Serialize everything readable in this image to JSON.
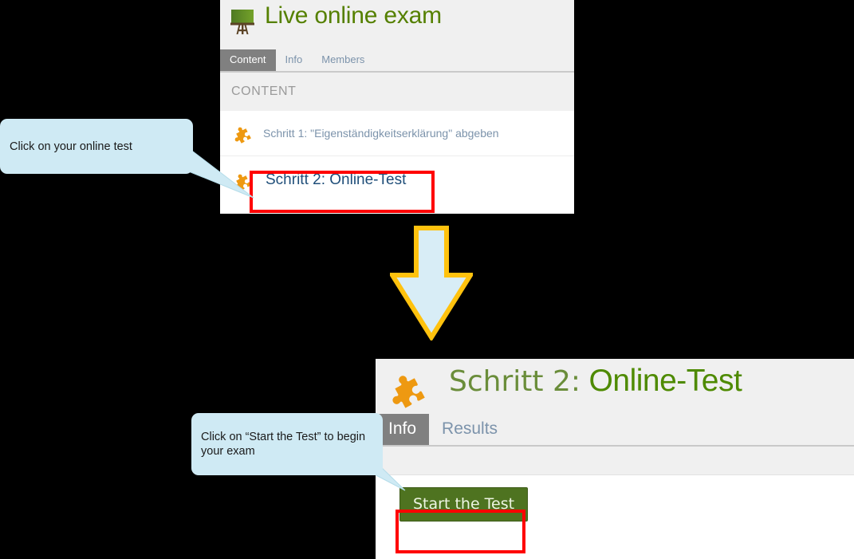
{
  "course_panel": {
    "icon": "easel-board-icon",
    "title": "Live online exam",
    "tabs": [
      {
        "label": "Content",
        "active": true
      },
      {
        "label": "Info",
        "active": false
      },
      {
        "label": "Members",
        "active": false
      }
    ],
    "section_label": "CONTENT",
    "rows": [
      {
        "icon": "puzzle-piece-icon",
        "label": "Schritt 1: \"Eigenständigkeitserklärung\" abgeben",
        "highlighted": false
      },
      {
        "icon": "puzzle-piece-icon",
        "label": "Schritt 2: Online-Test",
        "highlighted": true
      }
    ]
  },
  "test_panel": {
    "icon": "puzzle-piece-icon",
    "title_prefix": "Schritt 2:",
    "title_main": "Online-Test",
    "tabs": [
      {
        "label": "Info",
        "active": true
      },
      {
        "label": "Results",
        "active": false
      }
    ],
    "start_button_label": "Start the Test"
  },
  "callouts": [
    {
      "text": "Click on your online test"
    },
    {
      "text": "Click on “Start the Test” to begin your exam"
    }
  ],
  "annotations": {
    "arrow": "down-arrow",
    "highlight_color": "#ff0000",
    "callout_color": "#cfeaf4",
    "arrow_fill": "#d8edf6",
    "arrow_stroke": "#ffc20e"
  },
  "colors": {
    "course_title_green": "#558000",
    "test_title_green": "#4e8a00",
    "link_blue": "#7c93ab",
    "highlight_link_blue": "#1f4e79",
    "active_tab_gray": "#808080",
    "panel_head_gray": "#f0f0f0",
    "puzzle_orange": "#ee9911",
    "button_green": "#4e7320"
  }
}
